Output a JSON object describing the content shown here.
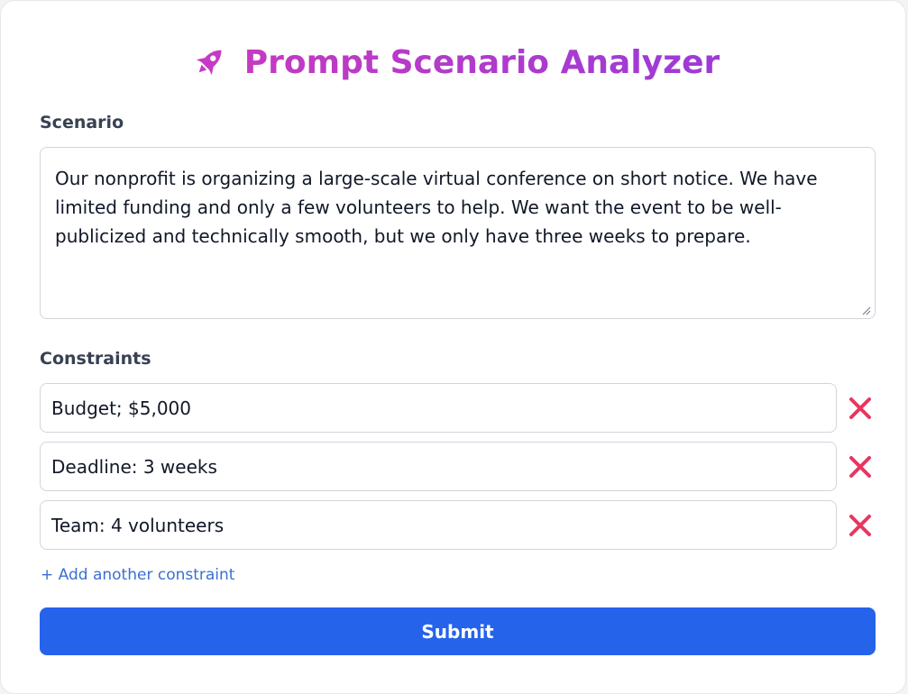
{
  "header": {
    "icon": "rocket-icon",
    "title": "Prompt Scenario Analyzer",
    "title_color": "#b43ccf"
  },
  "scenario": {
    "label": "Scenario",
    "value": "Our nonprofit is organizing a large-scale virtual conference on short notice. We have limited funding and only a few volunteers to help. We want the event to be well-publicized and technically smooth, but we only have three weeks to prepare."
  },
  "constraints": {
    "label": "Constraints",
    "items": [
      {
        "value": "Budget; $5,000",
        "remove_icon": "close-icon"
      },
      {
        "value": "Deadline: 3 weeks",
        "remove_icon": "close-icon"
      },
      {
        "value": "Team: 4 volunteers",
        "remove_icon": "close-icon"
      }
    ],
    "add_label": "+ Add another constraint",
    "remove_color": "#e8365f"
  },
  "submit": {
    "label": "Submit",
    "color": "#2563eb"
  }
}
